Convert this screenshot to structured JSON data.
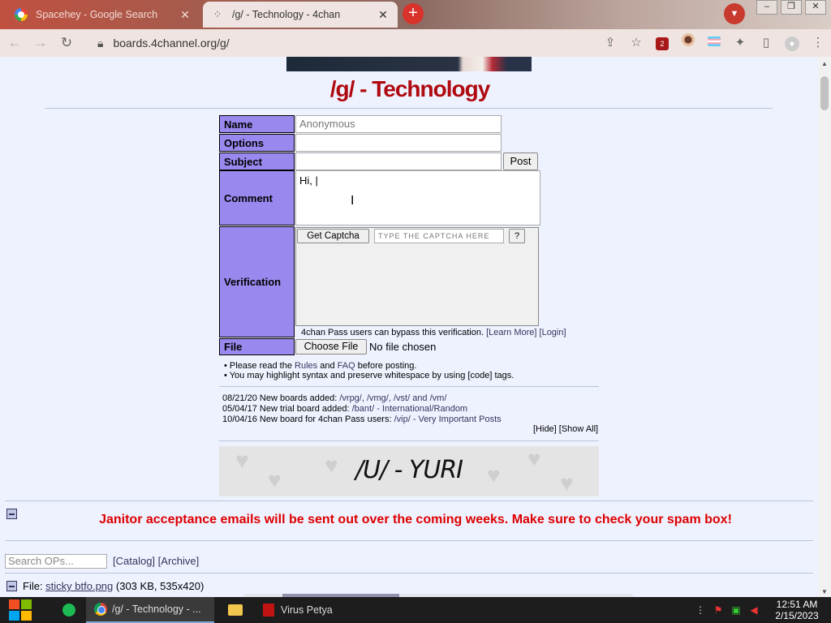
{
  "browser": {
    "tabs": [
      {
        "title": "Spacehey - Google Search",
        "active": false
      },
      {
        "title": "/g/ - Technology - 4chan",
        "active": true
      }
    ],
    "new_tab": "+",
    "url": "boards.4channel.org/g/",
    "ext_badge": "2"
  },
  "page": {
    "board_title": "/g/ - Technology",
    "form": {
      "name_label": "Name",
      "name_placeholder": "Anonymous",
      "options_label": "Options",
      "subject_label": "Subject",
      "post_button": "Post",
      "comment_label": "Comment",
      "comment_value": "Hi, |",
      "verification_label": "Verification",
      "get_captcha_button": "Get Captcha",
      "captcha_placeholder": "TYPE THE CAPTCHA HERE",
      "captcha_help": "?",
      "pass_note": "4chan Pass users can bypass this verification.",
      "learn_more": "[Learn More]",
      "login": "[Login]",
      "file_label": "File",
      "choose_file_button": "Choose File",
      "no_file": "No file chosen"
    },
    "rules": {
      "line1_pre": "• Please read the ",
      "rules_link": "Rules",
      "and": " and ",
      "faq_link": "FAQ",
      "line1_post": " before posting.",
      "line2": "• You may highlight syntax and preserve whitespace by using [code] tags."
    },
    "news": [
      {
        "date": "08/21/20",
        "text": "New boards added: ",
        "links": "/vrpg/, /vmg/, /vst/ and /vm/"
      },
      {
        "date": "05/04/17",
        "text": "New trial board added: ",
        "links": "/bant/ - International/Random"
      },
      {
        "date": "10/04/16",
        "text": "New board for 4chan Pass users: ",
        "links": "/vip/ - Very Important Posts"
      }
    ],
    "news_controls": "[Hide] [Show All]",
    "banner_text": "/U/ - YURI",
    "announcement": "Janitor acceptance emails will be sent out over the coming weeks. Make sure to check your spam box!",
    "search_placeholder": "Search OPs...",
    "catalog_link": "[Catalog]",
    "archive_link": "[Archive]",
    "file_label": "File: ",
    "file_name": "sticky btfo.png",
    "file_meta": " (303 KB, 535x420)"
  },
  "taskbar": {
    "chrome_label": "/g/ - Technology - ...",
    "virus_label": "Virus Petya",
    "time": "12:51 AM",
    "date": "2/15/2023"
  }
}
